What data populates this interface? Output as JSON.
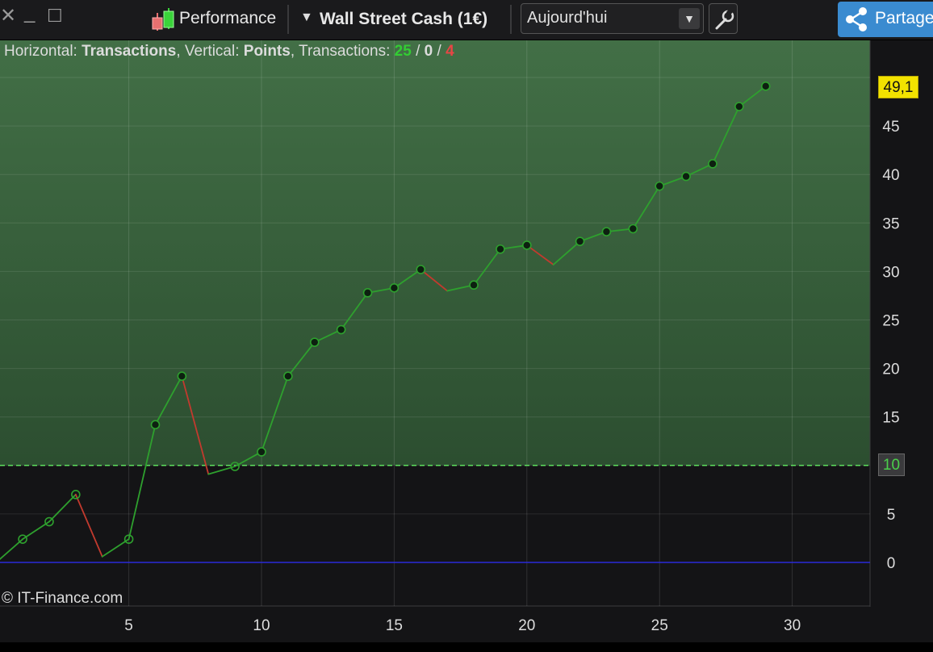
{
  "toolbar": {
    "close_symbol": "✕",
    "minimize_symbol": "_",
    "maximize_symbol": "☐",
    "tool_label": "Performance",
    "instrument_label": "Wall Street Cash (1€)",
    "period_value": "Aujourd'hui",
    "share_label": "Partager"
  },
  "info": {
    "horizontal_label": "Horizontal:",
    "horizontal_value": "Transactions",
    "vertical_label": "Vertical:",
    "vertical_value": "Points",
    "transactions_label": "Transactions:",
    "wins": "25",
    "draws": "0",
    "losses": "4",
    "sep": "/"
  },
  "badges": {
    "last_value": "49,1",
    "reference_value": "10"
  },
  "copyright": "© IT-Finance.com",
  "colors": {
    "gain_line": "#2ea02e",
    "loss_line": "#c23a2e",
    "zero_line": "#2a2ad8",
    "ref_line": "#5ee05e",
    "background_upper": "#3e6b42",
    "background_lower": "#141416",
    "marker_fill": "#0d2010",
    "share_button": "#3a8bd0"
  },
  "icons": {
    "close": "close-icon",
    "minimize": "minimize-icon",
    "maximize": "maximize-icon",
    "performance": "candlestick-icon",
    "dropdown": "chevron-down-icon",
    "settings": "wrench-icon",
    "share": "share-icon"
  },
  "chart_data": {
    "type": "line",
    "x_axis": "Transactions",
    "y_axis": "Points",
    "xlim": [
      0,
      33
    ],
    "ylim": [
      -4.5,
      50
    ],
    "x_ticks": [
      5,
      10,
      15,
      20,
      25,
      30
    ],
    "y_ticks": [
      0,
      5,
      10,
      15,
      20,
      25,
      30,
      35,
      40,
      45
    ],
    "reference_level": 10,
    "zero_level": 0,
    "grid": true,
    "points": [
      {
        "x": 0,
        "y": 0,
        "result": "start"
      },
      {
        "x": 1,
        "y": 2.4,
        "result": "gain"
      },
      {
        "x": 2,
        "y": 4.2,
        "result": "gain"
      },
      {
        "x": 3,
        "y": 7.0,
        "result": "gain"
      },
      {
        "x": 4,
        "y": 0.6,
        "result": "loss"
      },
      {
        "x": 5,
        "y": 2.4,
        "result": "gain"
      },
      {
        "x": 6,
        "y": 14.2,
        "result": "gain"
      },
      {
        "x": 7,
        "y": 19.2,
        "result": "gain"
      },
      {
        "x": 8,
        "y": 9.1,
        "result": "loss"
      },
      {
        "x": 9,
        "y": 9.9,
        "result": "gain"
      },
      {
        "x": 10,
        "y": 11.4,
        "result": "gain"
      },
      {
        "x": 11,
        "y": 19.2,
        "result": "gain"
      },
      {
        "x": 12,
        "y": 22.7,
        "result": "gain"
      },
      {
        "x": 13,
        "y": 24.0,
        "result": "gain"
      },
      {
        "x": 14,
        "y": 27.8,
        "result": "gain"
      },
      {
        "x": 15,
        "y": 28.3,
        "result": "gain"
      },
      {
        "x": 16,
        "y": 30.2,
        "result": "gain"
      },
      {
        "x": 17,
        "y": 28.0,
        "result": "loss"
      },
      {
        "x": 18,
        "y": 28.6,
        "result": "gain"
      },
      {
        "x": 19,
        "y": 32.3,
        "result": "gain"
      },
      {
        "x": 20,
        "y": 32.7,
        "result": "gain"
      },
      {
        "x": 21,
        "y": 30.7,
        "result": "loss"
      },
      {
        "x": 22,
        "y": 33.1,
        "result": "gain"
      },
      {
        "x": 23,
        "y": 34.1,
        "result": "gain"
      },
      {
        "x": 24,
        "y": 34.4,
        "result": "gain"
      },
      {
        "x": 25,
        "y": 38.8,
        "result": "gain"
      },
      {
        "x": 26,
        "y": 39.8,
        "result": "gain"
      },
      {
        "x": 27,
        "y": 41.1,
        "result": "gain"
      },
      {
        "x": 28,
        "y": 47.0,
        "result": "gain"
      },
      {
        "x": 29,
        "y": 49.1,
        "result": "gain"
      }
    ]
  }
}
